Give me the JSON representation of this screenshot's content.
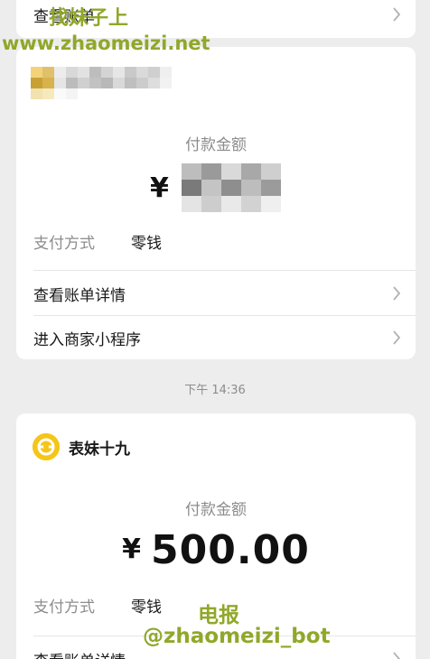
{
  "watermark": {
    "line1": "找妹子上",
    "line2": "www.zhaomeizi.net",
    "line3": "电报",
    "line4": "@zhaomeizi_bot"
  },
  "top_card": {
    "label": "查看账单"
  },
  "bill1": {
    "merchant_name": "",
    "amount_label": "付款金额",
    "currency": "¥",
    "amount_visible_prefix": "",
    "pay_method_key": "支付方式",
    "pay_method_value": "零钱",
    "link1": "查看账单详情",
    "link2": "进入商家小程序"
  },
  "timestamp": "下午 14:36",
  "bill2": {
    "merchant_name": "表妹十九",
    "amount_label": "付款金额",
    "currency": "¥",
    "amount": "500.00",
    "pay_method_key": "支付方式",
    "pay_method_value": "零钱",
    "link1": "查看账单详情"
  },
  "icons": {
    "chevron": "chevron-right-icon",
    "merchant_logo": "merchant-logo-icon"
  },
  "colors": {
    "background": "#ededed",
    "card": "#ffffff",
    "muted_text": "#8c8c8c",
    "watermark": "#8fa82a",
    "logo_yellow": "#f5c518"
  }
}
